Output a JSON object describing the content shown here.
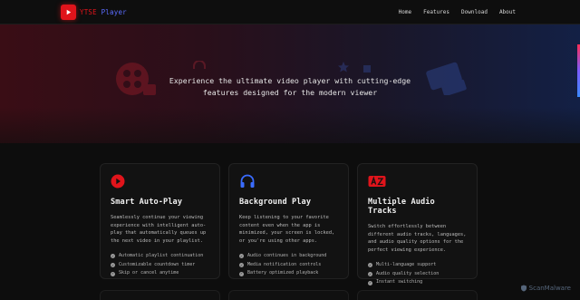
{
  "brand": {
    "name_part1": "YTSE",
    "name_part2": "Player"
  },
  "nav": {
    "items": [
      "Home",
      "Features",
      "Download",
      "About"
    ]
  },
  "hero": {
    "tagline": "Experience the ultimate video player with cutting-edge features designed for the modern viewer"
  },
  "colors": {
    "accent_red": "#e0141b",
    "accent_blue": "#3a6cff",
    "brand_blue": "#5b6cff"
  },
  "features": [
    {
      "icon": "play-circle-icon",
      "title": "Smart Auto-Play",
      "description": "Seamlessly continue your viewing experience with intelligent auto-play that automatically queues up the next video in your playlist.",
      "bullets": [
        "Automatic playlist continuation",
        "Customizable countdown timer",
        "Skip or cancel anytime"
      ]
    },
    {
      "icon": "headphones-icon",
      "title": "Background Play",
      "description": "Keep listening to your favorite content even when the app is minimized, your screen is locked, or you're using other apps.",
      "bullets": [
        "Audio continues in background",
        "Media notification controls",
        "Battery optimized playback"
      ]
    },
    {
      "icon": "audio-language-icon",
      "title": "Multiple Audio Tracks",
      "description": "Switch effortlessly between different audio tracks, languages, and audio quality options for the perfect viewing experience.",
      "bullets": [
        "Multi-language support",
        "Audio quality selection",
        "Instant switching"
      ]
    }
  ],
  "watermark": {
    "text": "ScanMalware"
  }
}
